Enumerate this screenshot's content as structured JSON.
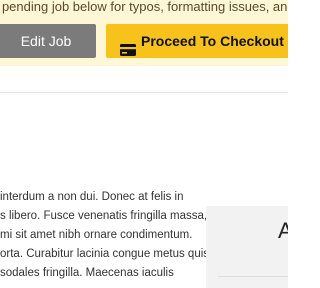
{
  "notice": {
    "text": "r pending job below for typos, formatting issues, and a"
  },
  "actions": {
    "edit_label": "Edit Job",
    "checkout_label": "Proceed To Checkout",
    "checkout_icon": "credit-card-icon"
  },
  "description": {
    "lines": [
      "interdum a non dui. Donec at felis in",
      "s libero. Fusce venenatis fringilla massa,",
      "mi sit amet nibh ornare condimentum.",
      "orta. Curabitur lacinia congue metus quis",
      "sodales fringilla. Maecenas iaculis"
    ]
  },
  "side_panel": {
    "heading": "A"
  },
  "colors": {
    "notice_bg": "#fdf7d5",
    "edit_button": "#7b7b7b",
    "checkout_button": "#f6c21b"
  }
}
